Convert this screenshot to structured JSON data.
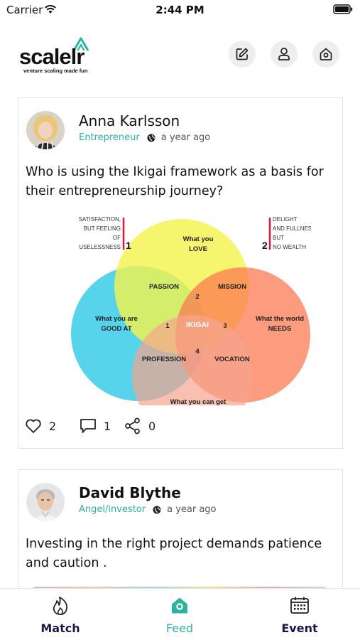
{
  "status_bar": {
    "carrier": "Carrier",
    "time": "2:44 PM"
  },
  "header": {
    "logo_text": "scalelr",
    "logo_tagline": "venture scaling made fun",
    "actions": [
      {
        "icon": "edit-icon"
      },
      {
        "icon": "profile-icon"
      },
      {
        "icon": "home-settings-icon"
      }
    ]
  },
  "posts": [
    {
      "author": "Anna Karlsson",
      "role": "Entrepreneur",
      "time": "a year ago",
      "text": "Who is using the Ikigai framework as a basis for their entrepreneurship journey?",
      "image": {
        "circles": [
          {
            "label_1": "What you",
            "label_2": "LOVE",
            "color": "#f4f24a"
          },
          {
            "label_1": "What you are",
            "label_2": "GOOD AT",
            "color": "#39cde8"
          },
          {
            "label_1": "What the world",
            "label_2": "NEEDS",
            "color": "#fb7a52"
          },
          {
            "label_1": "What you can get",
            "label_2": "",
            "color": "#f7a48f"
          }
        ],
        "overlaps": [
          "PASSION",
          "MISSION",
          "PROFESSION",
          "VOCATION"
        ],
        "center": "IKIGAI",
        "numbers": [
          "1",
          "2",
          "3",
          "4"
        ],
        "note_left": [
          "SATISFACTION,",
          "BUT FEELING",
          "OF",
          "USELESSNESS"
        ],
        "note_left_num": "1",
        "note_right": [
          "DELIGHT",
          "AND FULLNESS,",
          "BUT",
          "NO WEALTH"
        ],
        "note_right_num": "2"
      },
      "likes": "2",
      "comments": "1",
      "shares": "0"
    },
    {
      "author": "David Blythe",
      "role": "Angel/investor",
      "time": "a year ago",
      "text": "Investing in the right project demands patience and caution ."
    }
  ],
  "tabs": [
    {
      "label": "Match",
      "icon": "flame-icon",
      "active": false
    },
    {
      "label": "Feed",
      "icon": "home-icon",
      "active": true
    },
    {
      "label": "Event",
      "icon": "calendar-icon",
      "active": false
    }
  ],
  "colors": {
    "accent": "#2bb5a0",
    "tab_text": "#17174a"
  }
}
